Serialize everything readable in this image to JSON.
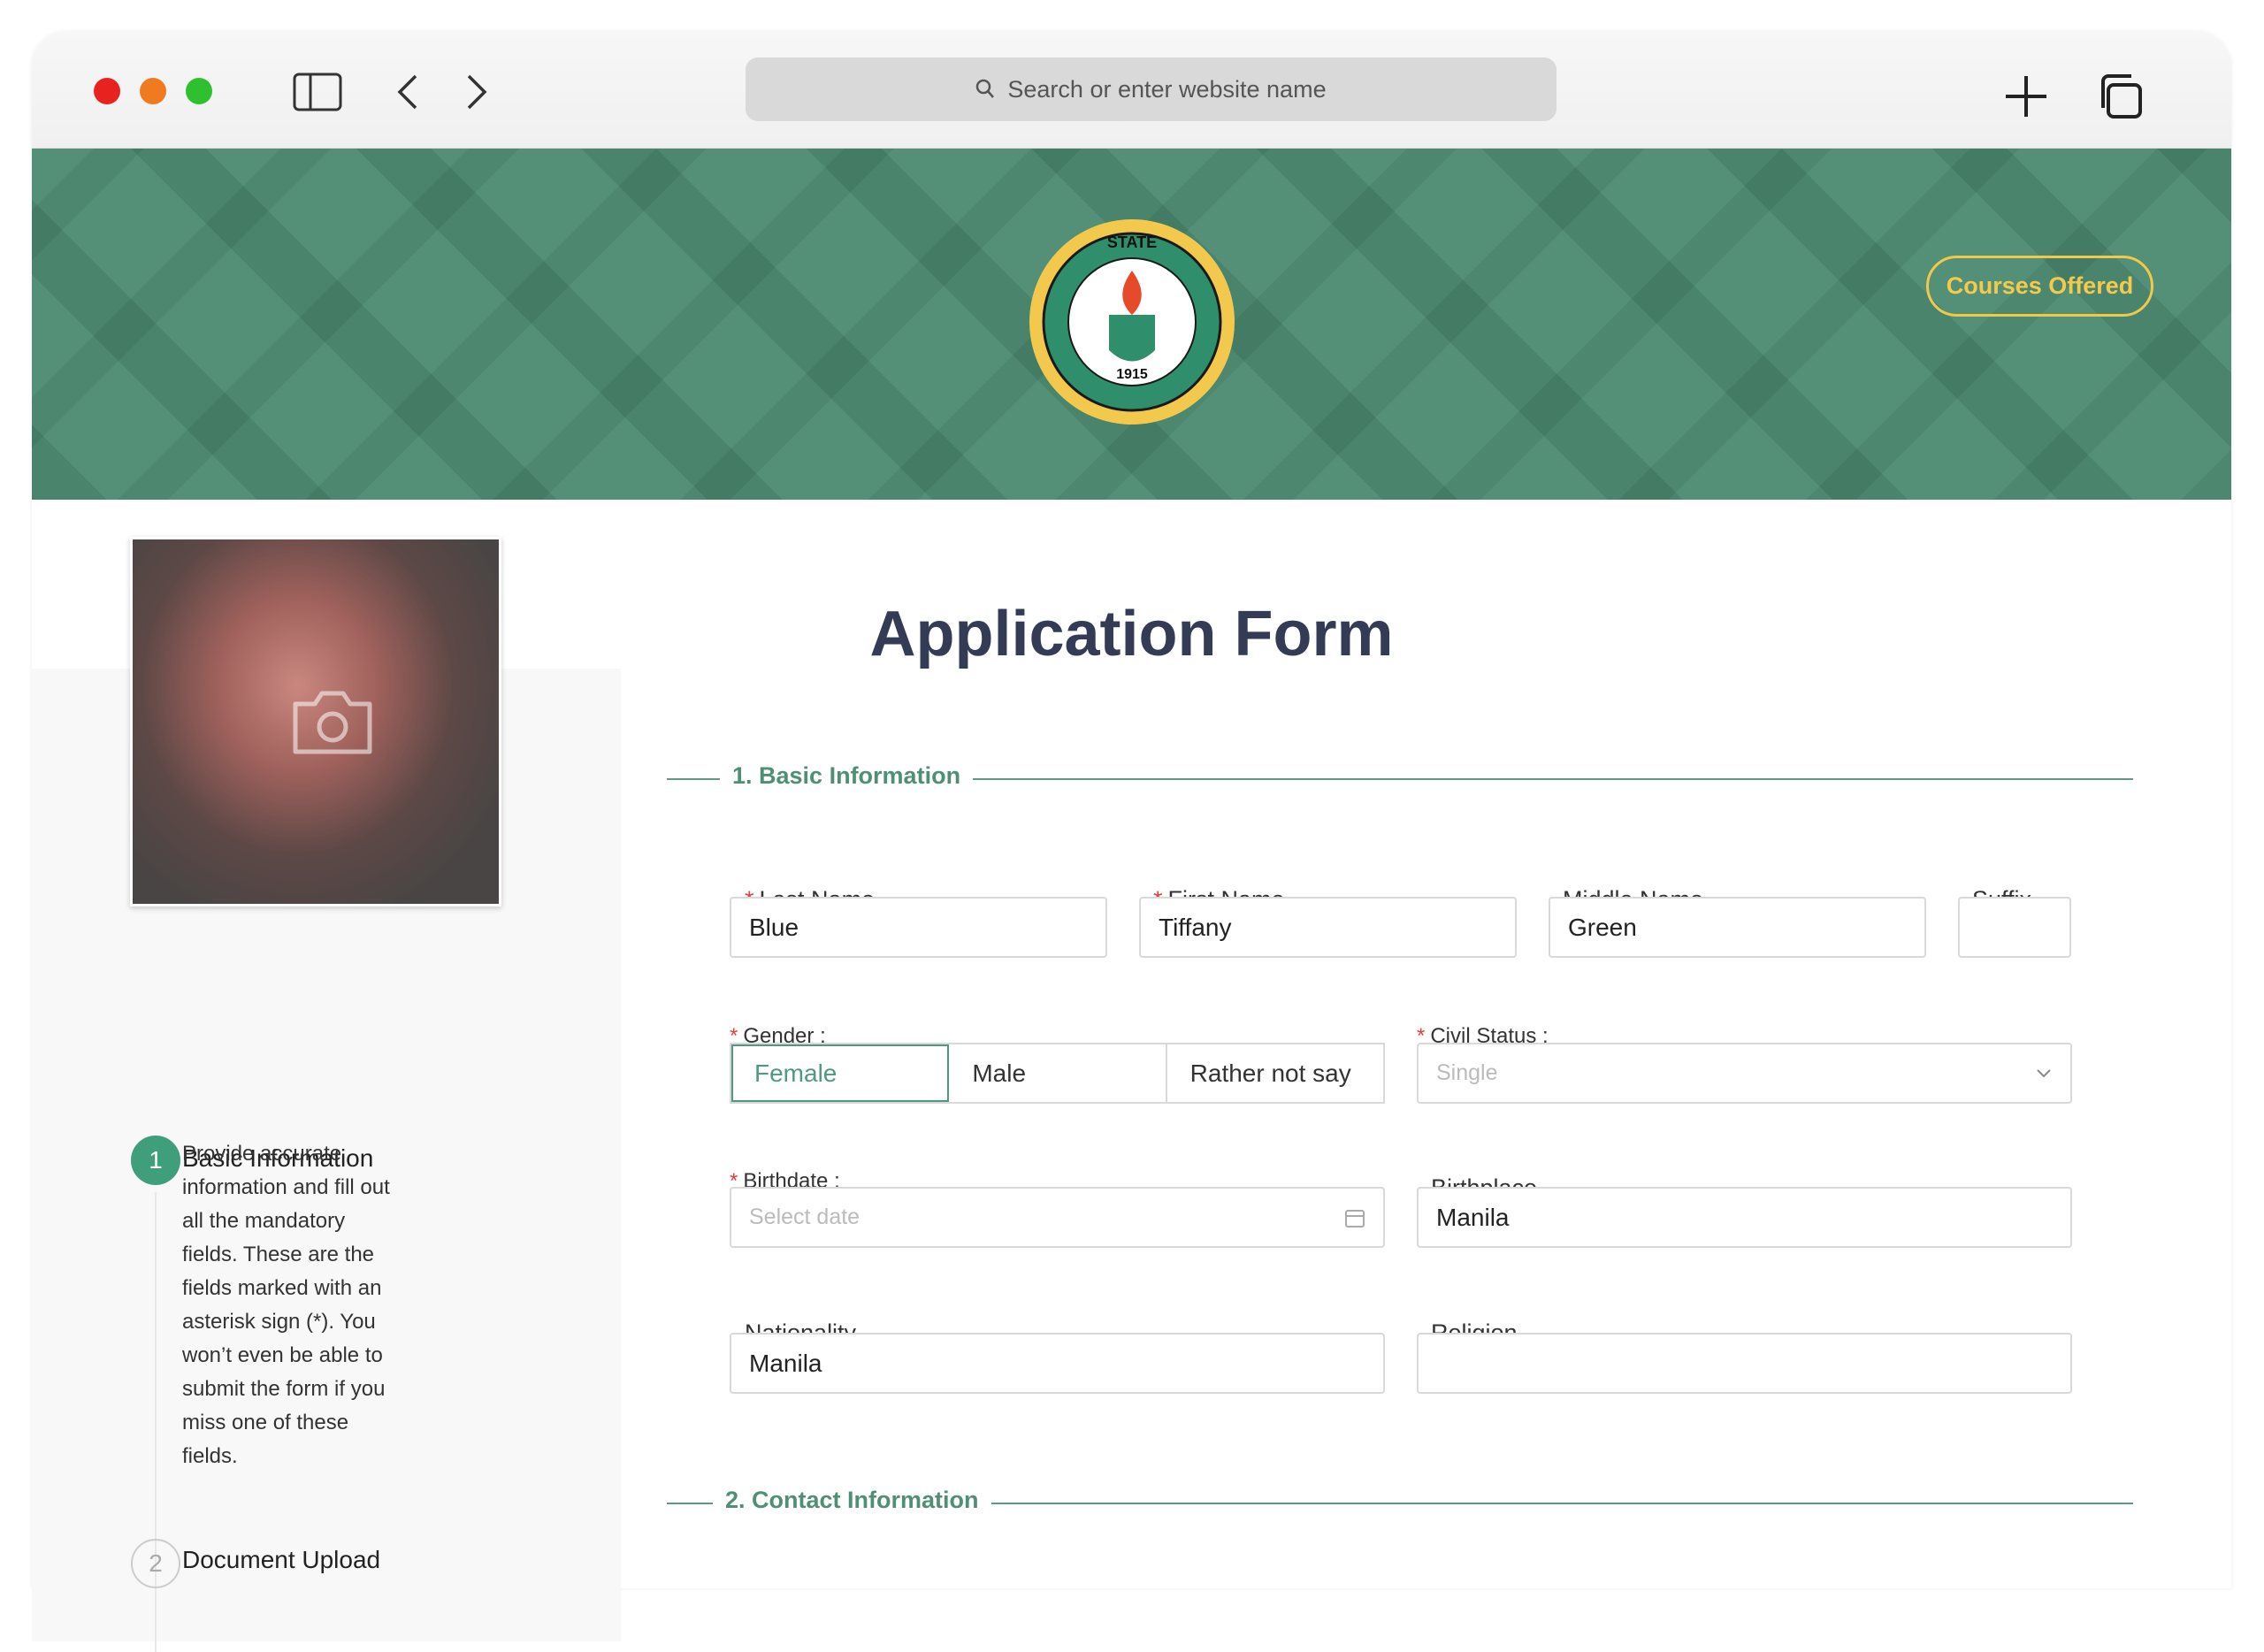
{
  "browser": {
    "url_placeholder": "Search or enter website name"
  },
  "header": {
    "courses_button": "Courses Offered",
    "logo_text": "ROMBLON STATE UNIVERSITY PHILIPPINES 1915"
  },
  "title": "Application Form",
  "steps": [
    {
      "number": "1",
      "title": "Basic Information",
      "description": "Provide accurate information and fill out all the mandatory fields. These are the fields marked with an asterisk sign (*). You won’t even be able to submit the form if you miss one of these fields."
    },
    {
      "number": "2",
      "title": "Document Upload"
    }
  ],
  "sections": {
    "basic": "1. Basic Information",
    "contact": "2. Contact Information"
  },
  "fields": {
    "last_name": {
      "label": "Last Name",
      "value": "Blue",
      "required": true
    },
    "first_name": {
      "label": "First Name",
      "value": "Tiffany",
      "required": true
    },
    "middle_name": {
      "label": "Middle Name",
      "value": "Green"
    },
    "suffix": {
      "label": "Suffix",
      "value": ""
    },
    "gender": {
      "label": "Gender :",
      "options": [
        "Female",
        "Male",
        "Rather not say"
      ],
      "selected": "Female",
      "required": true
    },
    "civil_status": {
      "label": "Civil Status :",
      "placeholder": "Single",
      "required": true
    },
    "birthdate": {
      "label": "Birthdate :",
      "placeholder": "Select date",
      "required": true
    },
    "birthplace": {
      "label": "Birthplace",
      "value": "Manila"
    },
    "nationality": {
      "label": "Nationality",
      "value": "Manila"
    },
    "religion": {
      "label": "Religion",
      "value": ""
    }
  },
  "colors": {
    "accent": "#3f9e7c",
    "banner": "#4b8a71",
    "gold": "#f0c94a"
  }
}
